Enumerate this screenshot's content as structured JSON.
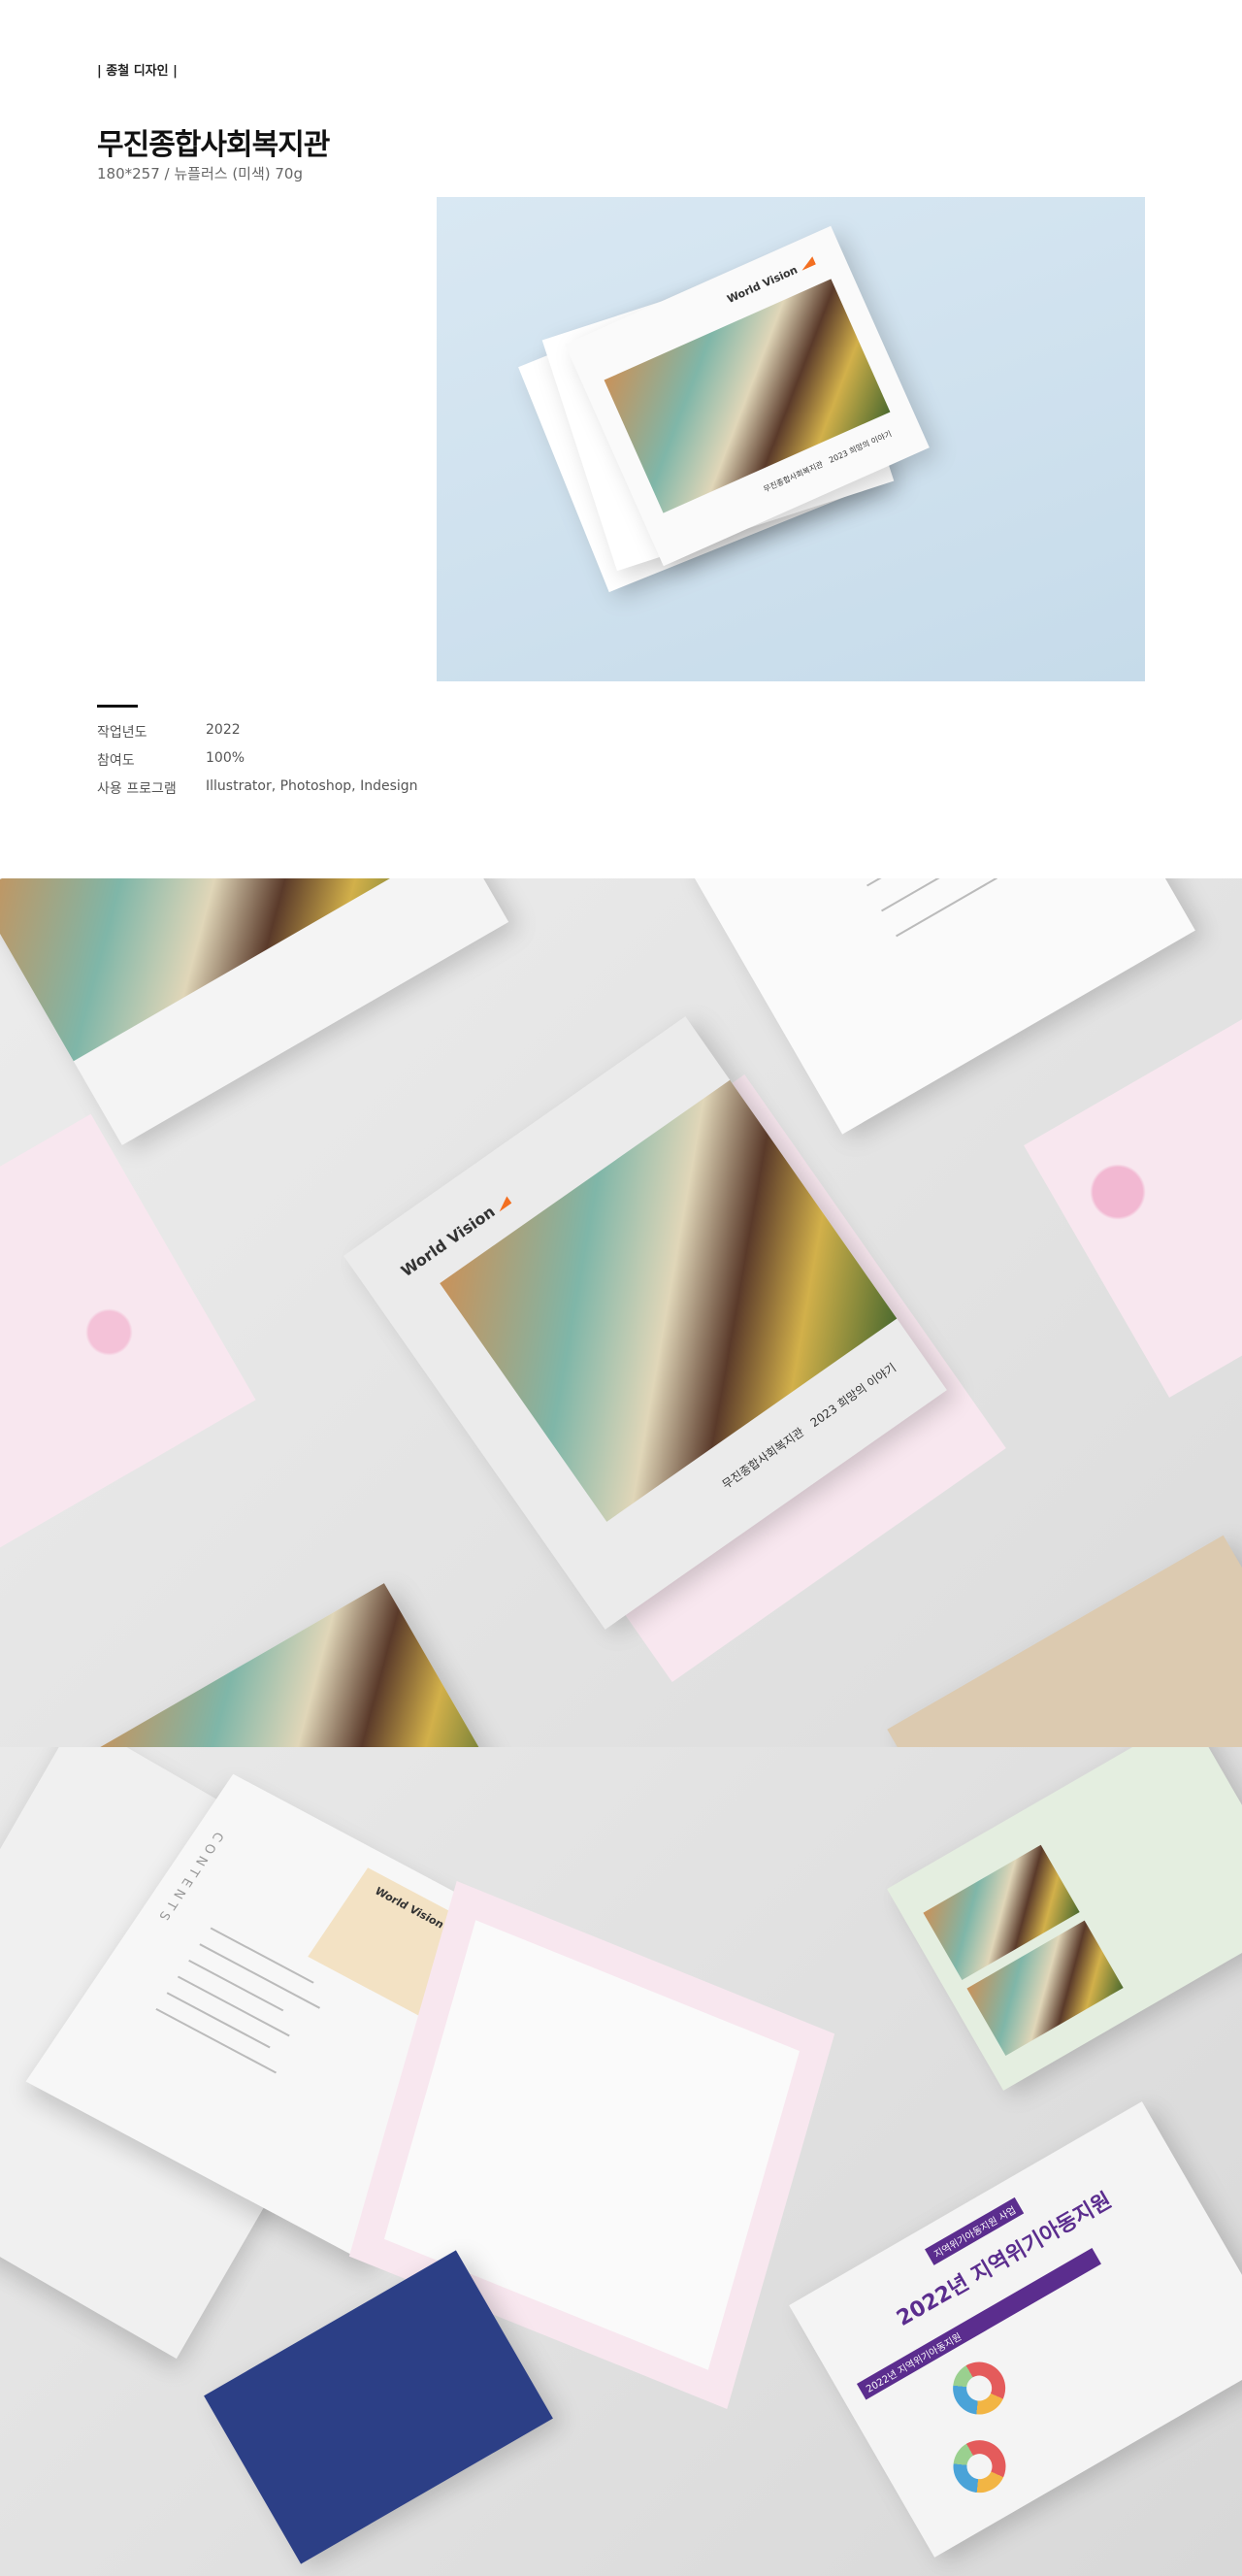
{
  "header": {
    "tag": "| 종철 디자인 |",
    "title": "무진종합사회복지관",
    "spec": "180*257 / 뉴플러스 (미색) 70g"
  },
  "info": [
    {
      "label": "작업년도",
      "value": "2022"
    },
    {
      "label": "참여도",
      "value": "100%"
    },
    {
      "label": "사용 프로그램",
      "value": "Illustrator, Photoshop, Indesign"
    }
  ],
  "cover": {
    "logo": "World Vision",
    "org": "무진종합사회복지관",
    "subtitle": "2023 희망의 이야기"
  },
  "spread": {
    "contents": "CONTENTS",
    "badge": "지역위기아동지원 사업",
    "heading": "2022년 지역위기아동지원",
    "bar": "2022년 지역위기아동지원"
  },
  "colors": {
    "accent": "#f36f21",
    "purple": "#5b2d8e",
    "pink": "#f2b8d2"
  }
}
